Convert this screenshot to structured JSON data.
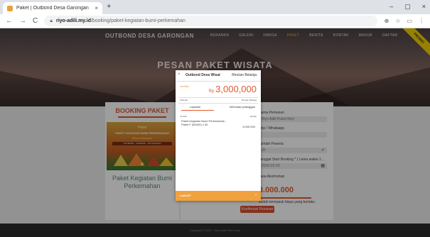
{
  "browser": {
    "tab_title": "Paket | Outbond Desa Garongan",
    "tab_close": "×",
    "new_tab": "+",
    "win_controls": [
      "–",
      "▢",
      "×"
    ],
    "nav_icons": [
      "←",
      "→",
      "C"
    ],
    "url_domain": "riyo-adili.my.id",
    "url_path": "/booking/paket-kegiatan-bumi-perkemahan",
    "right_icons": [
      "⊕",
      "☆",
      "▭",
      "⋮"
    ]
  },
  "site": {
    "brand": "OUTBOND DESA GARONGAN",
    "nav": [
      "BERANDA",
      "GALERI",
      "HARGA",
      "PAKET",
      "BERITA",
      "KONTAK",
      "MASUK",
      "DAFTAR"
    ],
    "nav_active_index": 3,
    "hero_title": "PESAN PAKET WISATA",
    "ribbon": "PROMO",
    "accent": "#e05b2f",
    "footer": "Copyright © 2020 - Riyo Adili Putra Hery"
  },
  "booking_card": {
    "title": "BOOKING PAKET",
    "poster_script": "Paket",
    "poster_title": "PAKET KEGIATAN BUMI PERKEMAHAN",
    "poster_sub": "Desa Garongan",
    "poster_band": "OUTBOND · CAMPING · API UNGGUN",
    "package_name": "Paket Kegiatan Bumi Perkemahan"
  },
  "form": {
    "field1_label": "Nama Pemesan",
    "field1_value": "Riyo Adili Putra Hery",
    "field2_label": "Telp / Whatsapp",
    "field2_value": "",
    "field3_label": "Jumlah Peserta",
    "field3_value": "30",
    "field4_label": "Tanggal Start Booking * ( Lama waktu 1 ..",
    "field4_value": "2020-02-20",
    "field5_label": "Jasa Akomodasi",
    "price": "3.000.000",
    "note": "sudah termasuk biaya yang berlaku",
    "submit": "Konfirmasi Pesanan",
    "check_icon": "✔",
    "calendar_icon": "▦"
  },
  "modal": {
    "close": "×",
    "title": "Outbond Desa Wisat",
    "right": "Rincian Belanja",
    "jumlah_label": "Jumlah",
    "currency": "Rp",
    "total": "3,000,000",
    "row1_left": "Subtotal",
    "row1_right": "Rincian Belanja",
    "tab_left": "Layanan",
    "tab_right": "Informasi pelanggan",
    "col_left": "Jumlah",
    "col_right": "Jumlah",
    "item_name": "Paket Kegiatan Bumi Perkemahan - Paket F (80000) x 30",
    "item_price": "3,000,000",
    "footer_btn": "LANJUT",
    "footer_arrow": "›"
  }
}
